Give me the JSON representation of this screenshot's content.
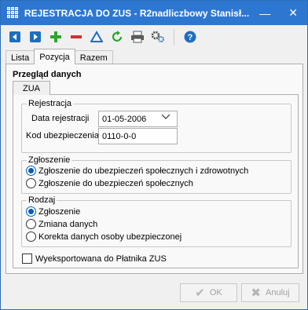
{
  "window": {
    "title": "REJESTRACJA DO ZUS - R2nadliczbowy Stanisł...",
    "minimize": "—",
    "maximize": "☐",
    "close": "✕"
  },
  "toolbar": {
    "icons": [
      "arrow-left-icon",
      "arrow-right-icon",
      "plus-icon",
      "minus-icon",
      "triangle-icon",
      "refresh-icon",
      "printer-icon",
      "gears-icon",
      "help-icon"
    ],
    "colors": {
      "blue": "#1e6ebf",
      "green": "#2ca52c",
      "red": "#d03030"
    }
  },
  "tabs": [
    "Lista",
    "Pozycja",
    "Razem"
  ],
  "panel": {
    "title": "Przegląd danych",
    "subtab": "ZUA"
  },
  "rejestracja": {
    "legend": "Rejestracja",
    "data_label": "Data rejestracji",
    "data_value": "01-05-2006",
    "kod_label": "Kod ubezpieczenia",
    "kod_value": "0110-0-0"
  },
  "zgloszenie": {
    "legend": "Zgłoszenie",
    "options": [
      "Zgłoszenie do ubezpieczeń społecznych i zdrowotnych",
      "Zgłoszenie do ubezpieczeń społecznych"
    ],
    "selected": 0
  },
  "rodzaj": {
    "legend": "Rodzaj",
    "options": [
      "Zgłoszenie",
      "Zmiana danych",
      "Korekta danych osoby ubezpieczonej"
    ],
    "selected": 0
  },
  "export_checkbox": "Wyeksportowana do Płatnika ZUS",
  "buttons": {
    "ok": "OK",
    "cancel": "Anuluj"
  }
}
